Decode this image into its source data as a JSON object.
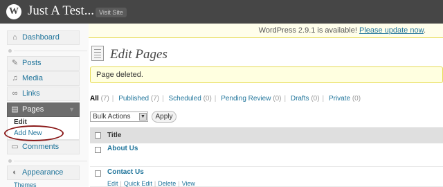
{
  "header": {
    "site_title": "Just A Test...",
    "visit_site": "Visit Site",
    "logo_glyph": "W"
  },
  "sidebar": {
    "dashboard": "Dashboard",
    "posts": "Posts",
    "media": "Media",
    "links": "Links",
    "pages": "Pages",
    "pages_submenu": {
      "edit": "Edit",
      "add_new": "Add New"
    },
    "comments": "Comments",
    "appearance": "Appearance",
    "themes": "Themes"
  },
  "update_nag": {
    "text": "WordPress 2.9.1 is available!",
    "link": "Please update now",
    "end": "."
  },
  "main": {
    "title": "Edit Pages",
    "notice": "Page deleted.",
    "filters": [
      {
        "label": "All",
        "count": "(7)"
      },
      {
        "label": "Published",
        "count": "(7)"
      },
      {
        "label": "Scheduled",
        "count": "(0)"
      },
      {
        "label": "Pending Review",
        "count": "(0)"
      },
      {
        "label": "Drafts",
        "count": "(0)"
      },
      {
        "label": "Private",
        "count": "(0)"
      }
    ],
    "bulk_actions": "Bulk Actions",
    "apply": "Apply",
    "column_title": "Title",
    "rows": [
      {
        "title": "About Us"
      },
      {
        "title": "Contact Us",
        "actions": [
          "Edit",
          "Quick Edit",
          "Delete",
          "View"
        ]
      }
    ]
  },
  "colors": {
    "link": "#21759b",
    "header": "#464646",
    "notice_bg": "#ffffe0",
    "highlight": "#8b1a1a"
  }
}
